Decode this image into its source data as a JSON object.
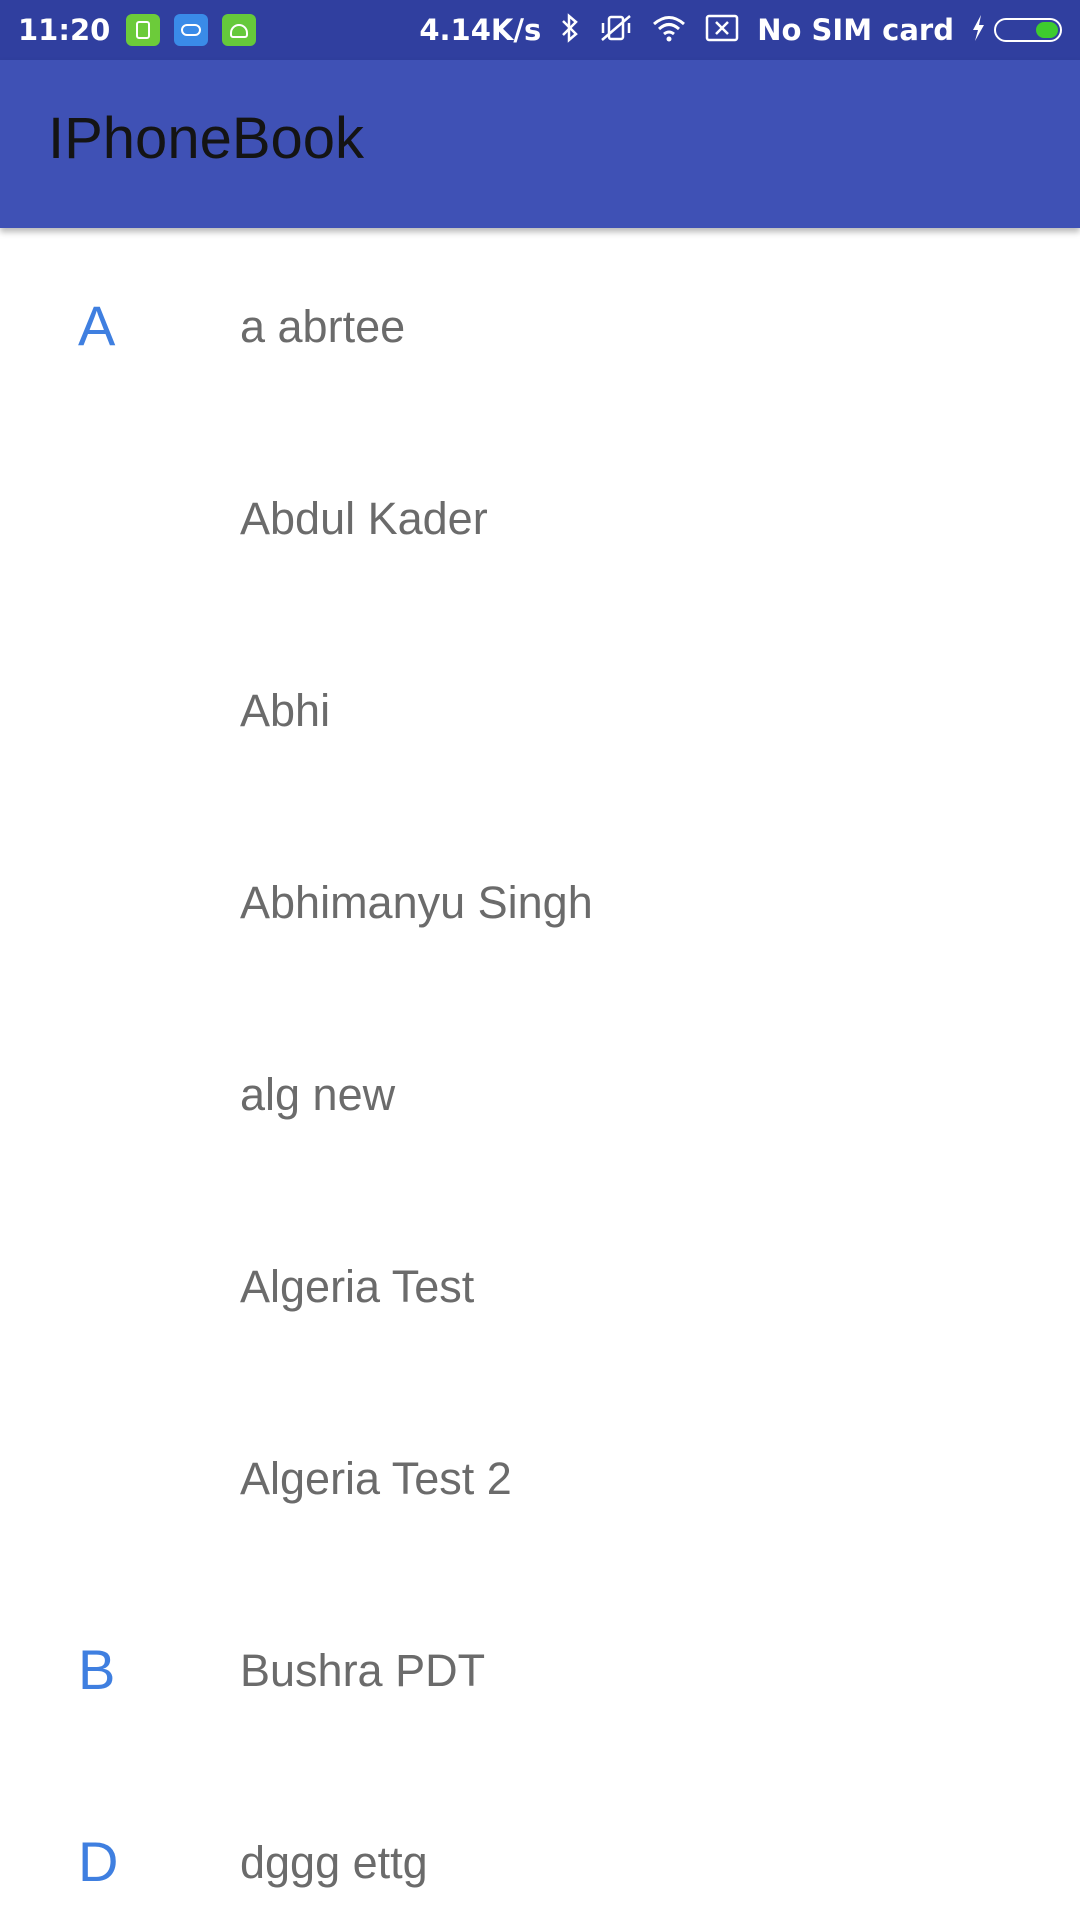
{
  "status_bar": {
    "time": "11:20",
    "net_speed": "4.14K/s",
    "sim_status": "No SIM card",
    "icons": [
      "battery-saver-icon",
      "cloud-icon",
      "android-icon",
      "bluetooth-icon",
      "vibrate-off-icon",
      "wifi-icon",
      "no-sim-icon",
      "charging-icon",
      "battery-icon"
    ]
  },
  "toolbar": {
    "title": "IPhoneBook"
  },
  "contacts": [
    {
      "letter": "A",
      "name": "a abrtee"
    },
    {
      "letter": "",
      "name": "Abdul Kader"
    },
    {
      "letter": "",
      "name": "Abhi"
    },
    {
      "letter": "",
      "name": "Abhimanyu Singh"
    },
    {
      "letter": "",
      "name": "alg new"
    },
    {
      "letter": "",
      "name": "Algeria Test"
    },
    {
      "letter": "",
      "name": "Algeria Test 2"
    },
    {
      "letter": "B",
      "name": "Bushra PDT"
    },
    {
      "letter": "D",
      "name": "dggg ettg"
    }
  ],
  "colors": {
    "status_bar": "#303f9f",
    "toolbar": "#3f51b5",
    "section_letter": "#3f7fe0",
    "contact_name": "#6b6b6b"
  }
}
